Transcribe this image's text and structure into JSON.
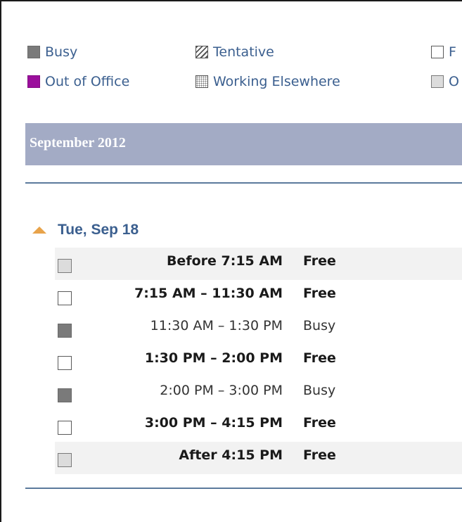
{
  "legend": {
    "busy": "Busy",
    "tentative": "Tentative",
    "free": "F",
    "out_of_office": "Out of Office",
    "working_elsewhere": "Working Elsewhere",
    "other": "O"
  },
  "month": {
    "title": "September 2012"
  },
  "day": {
    "label": "Tue, Sep 18"
  },
  "slots": [
    {
      "time": "Before 7:15 AM",
      "status": "Free",
      "swatch": "other",
      "bold": true,
      "shaded": true
    },
    {
      "time": "7:15 AM – 11:30 AM",
      "status": "Free",
      "swatch": "free",
      "bold": true,
      "shaded": false
    },
    {
      "time": "11:30 AM – 1:30 PM",
      "status": "Busy",
      "swatch": "busy",
      "bold": false,
      "shaded": false
    },
    {
      "time": "1:30 PM – 2:00 PM",
      "status": "Free",
      "swatch": "free",
      "bold": true,
      "shaded": false
    },
    {
      "time": "2:00 PM – 3:00 PM",
      "status": "Busy",
      "swatch": "busy",
      "bold": false,
      "shaded": false
    },
    {
      "time": "3:00 PM – 4:15 PM",
      "status": "Free",
      "swatch": "free",
      "bold": true,
      "shaded": false
    },
    {
      "time": "After 4:15 PM",
      "status": "Free",
      "swatch": "other",
      "bold": true,
      "shaded": true
    }
  ],
  "colors": {
    "busy": "#7a7a7a",
    "out_of_office": "#9b0f9c",
    "month_banner": "#a3abc5",
    "link_text": "#3b5f8f",
    "collapse_arrow": "#e8a34a"
  }
}
